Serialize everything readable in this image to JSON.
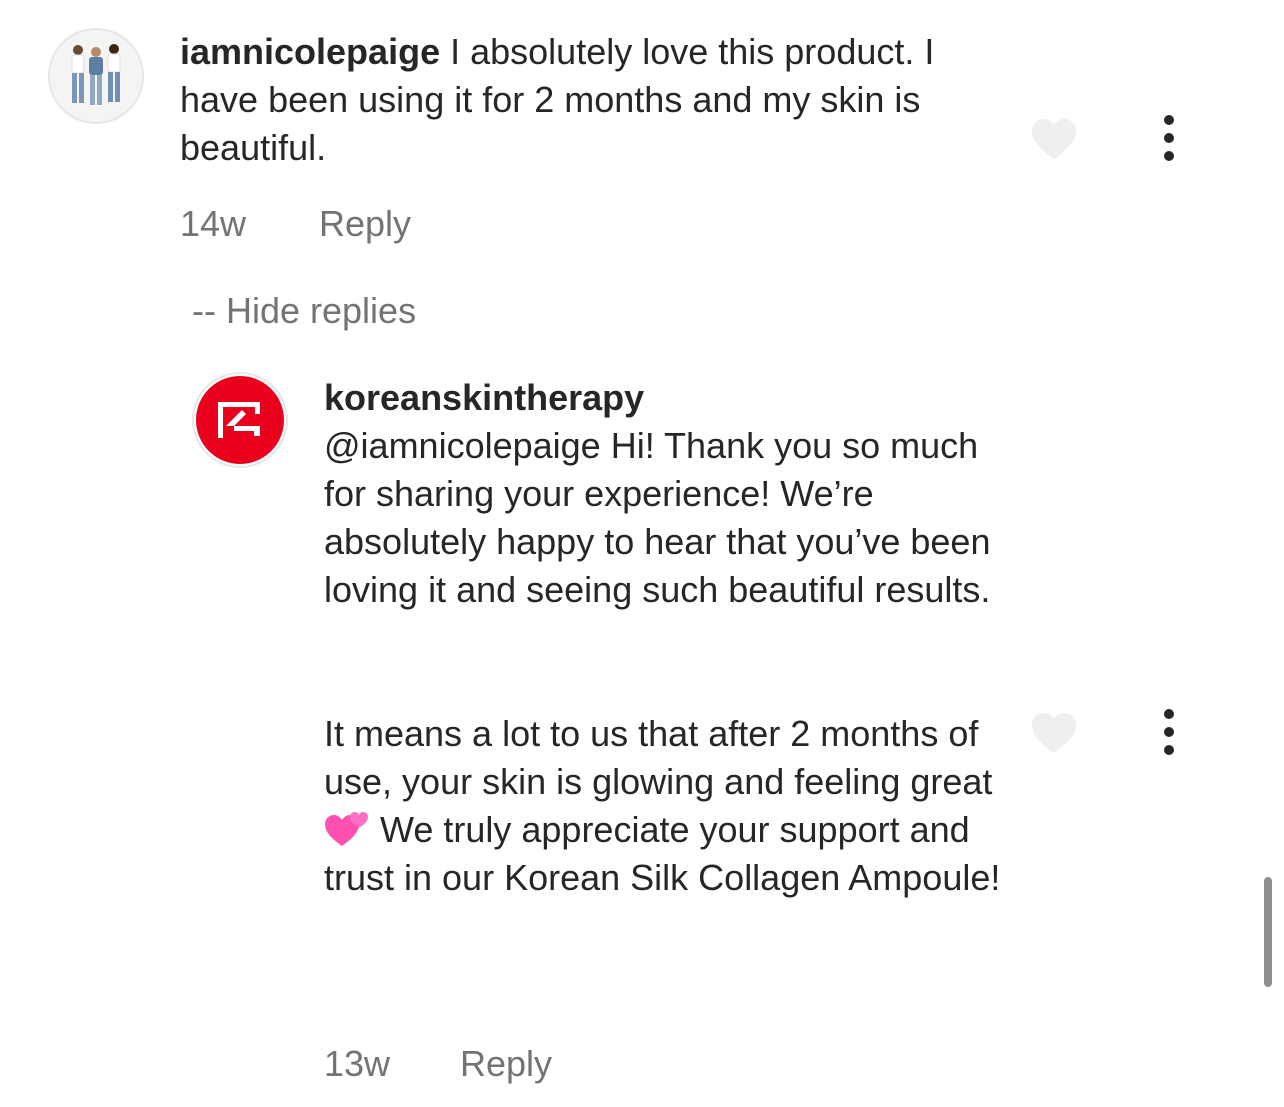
{
  "comment": {
    "username": "iamnicolepaige",
    "text": "I absolutely love this product. I have been using it for 2 months and my skin is beautiful.",
    "time": "14w",
    "reply_label": "Reply"
  },
  "hide_replies_label": "-- Hide replies",
  "reply": {
    "username": "koreanskintherapy",
    "paragraph_1": "@iamnicolepaige Hi! Thank you so much for sharing your experience! We’re absolutely happy to hear that you’ve been loving it and seeing such beautiful results.",
    "paragraph_2_before_emoji": "It means a lot to us that after 2 months of use, your skin is glowing and feeling great",
    "emoji": "two-hearts",
    "paragraph_2_after_emoji": "We truly appreciate your support and trust in our Korean Silk Collagen Ampoule!",
    "time": "13w",
    "reply_label": "Reply"
  },
  "icons": {
    "like": "heart-outline-icon",
    "more": "more-vertical-icon"
  },
  "colors": {
    "text": "#262626",
    "secondary_text": "#737373",
    "brand_logo": "#e8001c",
    "heart": "#efefef"
  }
}
